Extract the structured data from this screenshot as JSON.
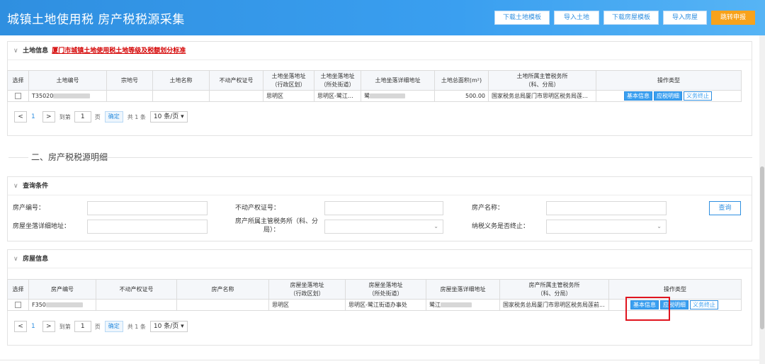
{
  "header": {
    "title": "城镇土地使用税 房产税税源采集",
    "buttons": [
      "下载土地模板",
      "导入土地",
      "下载房屋模板",
      "导入房屋",
      "跳转申报"
    ]
  },
  "land": {
    "panel_title": "土地信息",
    "link": "厦门市城镇土地使用税土地等级及税额划分标准",
    "columns": [
      "选择",
      "土地编号",
      "宗地号",
      "土地名称",
      "不动产权证号",
      "土地坐落地址\n（行政区划）",
      "土地坐落地址\n（所处街道）",
      "土地坐落详细地址",
      "土地总面积(m²)",
      "土地所属主管税务所\n（科、分局）",
      "操作类型"
    ],
    "row": {
      "id": "T35020",
      "district": "思明区",
      "street": "思明区-鹭江街...",
      "address_prefix": "鹭",
      "area": "500.00",
      "tax_office": "国家税务总局厦门市思明区税务局莲前...",
      "actions": [
        "基本信息",
        "应税明细",
        "义务终止"
      ]
    }
  },
  "pager": {
    "page": "1",
    "goto_label": "到第",
    "page_input": "1",
    "page_unit": "页",
    "ok": "确定",
    "total": "共 1 条",
    "size": "10 条/页"
  },
  "house_section": {
    "title": "二、房产税税源明细"
  },
  "query": {
    "panel_title": "查询条件",
    "labels": {
      "house_no": "房产编号：",
      "cert_no": "不动产权证号：",
      "house_name": "房产名称：",
      "address": "房屋坐落详细地址：",
      "tax_office_line1": "房产所属主管税务所（科、分",
      "tax_office_line2": "局）：",
      "terminated": "纳税义务是否终止："
    },
    "search_button": "查询"
  },
  "house": {
    "panel_title": "房屋信息",
    "columns": [
      "选择",
      "房产编号",
      "不动产权证号",
      "房产名称",
      "房屋坐落地址\n（行政区划）",
      "房屋坐落地址\n（所处街道）",
      "房屋坐落详细地址",
      "房产所属主管税务所\n（科、分局）",
      "操作类型"
    ],
    "row": {
      "id": "F350",
      "district": "思明区",
      "street": "思明区-鹭江街道办事处",
      "address_prefix": "鹭江",
      "tax_office": "国家税务总局厦门市思明区税务局莲前...",
      "actions": [
        "基本信息",
        "应税明细",
        "义务终止"
      ]
    }
  },
  "icons": {
    "collapse": "chevron-down-icon",
    "select_arrow": "caret-down-icon",
    "prev": "chevron-left-icon",
    "next": "chevron-right-icon"
  },
  "colors": {
    "brand": "#3a9ff0",
    "accent": "#f7a21b",
    "highlight": "#e0141e",
    "link": "#d40000"
  }
}
